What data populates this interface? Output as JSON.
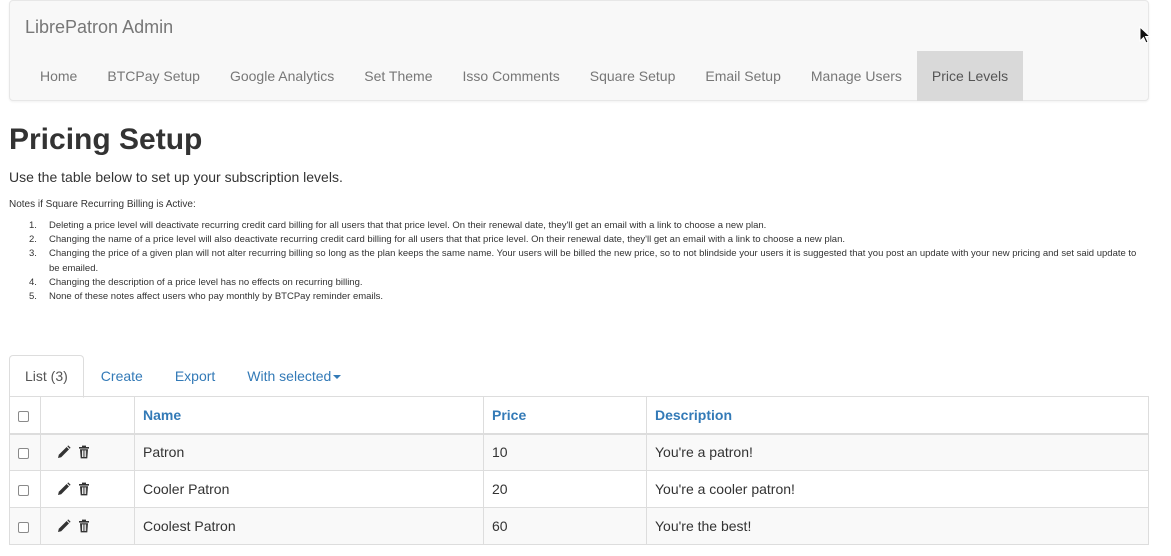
{
  "navbar": {
    "brand": "LibrePatron Admin",
    "items": [
      {
        "label": "Home"
      },
      {
        "label": "BTCPay Setup"
      },
      {
        "label": "Google Analytics"
      },
      {
        "label": "Set Theme"
      },
      {
        "label": "Isso Comments"
      },
      {
        "label": "Square Setup"
      },
      {
        "label": "Email Setup"
      },
      {
        "label": "Manage Users"
      },
      {
        "label": "Price Levels",
        "active": true
      }
    ]
  },
  "page": {
    "title": "Pricing Setup",
    "intro": "Use the table below to set up your subscription levels.",
    "notes_title": "Notes if Square Recurring Billing is Active:",
    "notes": [
      {
        "num": "1.",
        "text": "Deleting a price level will deactivate recurring credit card billing for all users that that price level. On their renewal date, they'll get an email with a link to choose a new plan."
      },
      {
        "num": "2.",
        "text": "Changing the name of a price level will also deactivate recurring credit card billing for all users that that price level. On their renewal date, they'll get an email with a link to choose a new plan."
      },
      {
        "num": "3.",
        "text": "Changing the price of a given plan will not alter recurring billing so long as the plan keeps the same name. Your users will be billed the new price, so to not blindside your users it is suggested that you post an update with your new pricing and set said update to be emailed."
      },
      {
        "num": "4.",
        "text": "Changing the description of a price level has no effects on recurring billing."
      },
      {
        "num": "5.",
        "text": "None of these notes affect users who pay monthly by BTCPay reminder emails."
      }
    ]
  },
  "tabs": {
    "list": "List (3)",
    "create": "Create",
    "export": "Export",
    "with_selected": "With selected"
  },
  "table": {
    "columns": {
      "name": "Name",
      "price": "Price",
      "description": "Description"
    },
    "rows": [
      {
        "name": "Patron",
        "price": "10",
        "description": "You're a patron!"
      },
      {
        "name": "Cooler Patron",
        "price": "20",
        "description": "You're a cooler patron!"
      },
      {
        "name": "Coolest Patron",
        "price": "60",
        "description": "You're the best!"
      }
    ]
  },
  "colors": {
    "link": "#337ab7",
    "nav_text": "#777777",
    "nav_active_bg": "#d9d9d9",
    "navbar_bg": "#f8f8f8"
  },
  "icons": {
    "edit": "pencil-icon",
    "delete": "trash-icon",
    "cursor": "mouse-pointer-icon"
  }
}
